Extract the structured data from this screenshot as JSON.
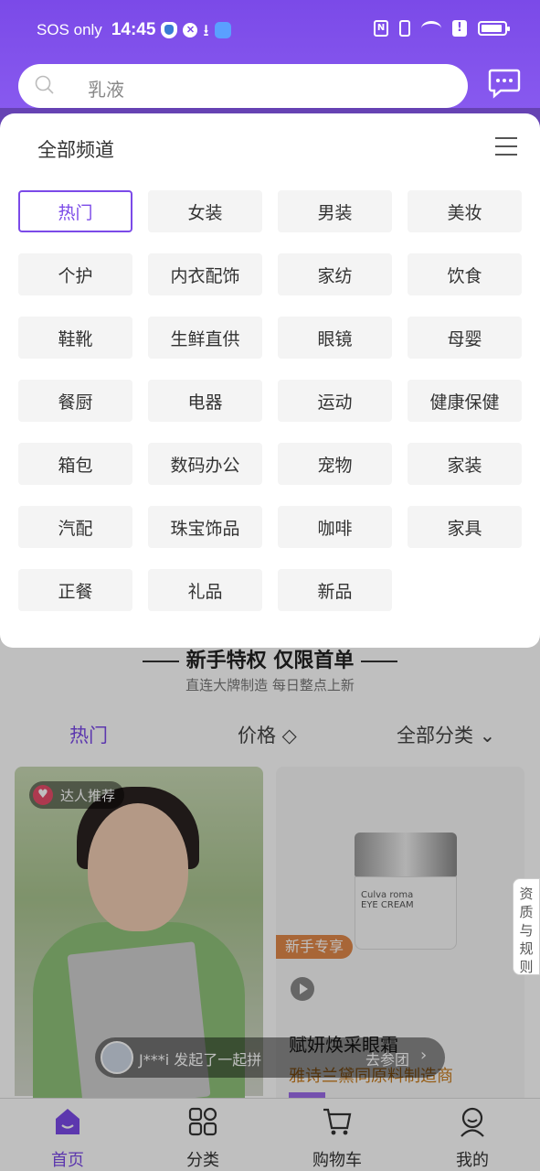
{
  "status_bar": {
    "carrier": "SOS only",
    "time": "14:45"
  },
  "search": {
    "placeholder": "乳液",
    "icon": "search-icon"
  },
  "header": {
    "chat_icon": "chat-bubble-icon"
  },
  "channel_panel": {
    "title": "全部频道",
    "menu_icon": "menu-icon",
    "channels": [
      {
        "label": "热门",
        "active": true
      },
      {
        "label": "女装",
        "active": false
      },
      {
        "label": "男装",
        "active": false
      },
      {
        "label": "美妆",
        "active": false
      },
      {
        "label": "个护",
        "active": false
      },
      {
        "label": "内衣配饰",
        "active": false
      },
      {
        "label": "家纺",
        "active": false
      },
      {
        "label": "饮食",
        "active": false
      },
      {
        "label": "鞋靴",
        "active": false
      },
      {
        "label": "生鲜直供",
        "active": false
      },
      {
        "label": "眼镜",
        "active": false
      },
      {
        "label": "母婴",
        "active": false
      },
      {
        "label": "餐厨",
        "active": false
      },
      {
        "label": "电器",
        "active": false
      },
      {
        "label": "运动",
        "active": false
      },
      {
        "label": "健康保健",
        "active": false
      },
      {
        "label": "箱包",
        "active": false
      },
      {
        "label": "数码办公",
        "active": false
      },
      {
        "label": "宠物",
        "active": false
      },
      {
        "label": "家装",
        "active": false
      },
      {
        "label": "汽配",
        "active": false
      },
      {
        "label": "珠宝饰品",
        "active": false
      },
      {
        "label": "咖啡",
        "active": false
      },
      {
        "label": "家具",
        "active": false
      },
      {
        "label": "正餐",
        "active": false
      },
      {
        "label": "礼品",
        "active": false
      },
      {
        "label": "新品",
        "active": false
      }
    ]
  },
  "promo": {
    "title": "新手特权 仅限首单",
    "subtitle": "直连大牌制造   每日整点上新"
  },
  "filters": {
    "hot": "热门",
    "price": "价格 ◇",
    "category": "全部分类 ⌄"
  },
  "cards": {
    "left": {
      "badge": "达人推荐"
    },
    "right": {
      "tag": "新手专享",
      "name": "赋妍焕采眼霜",
      "desc": "雅诗兰黛同原料制造商",
      "jar_brand": "Culva roma",
      "jar_label": "EYE CREAM"
    }
  },
  "join_banner": {
    "text": "J***i 发起了一起拼",
    "action": "去参团",
    "chevron": "›"
  },
  "rules_tab": {
    "label": "资质与规则"
  },
  "bottom_nav": {
    "items": [
      {
        "label": "首页",
        "icon": "home-icon"
      },
      {
        "label": "分类",
        "icon": "grid-icon"
      },
      {
        "label": "购物车",
        "icon": "cart-icon"
      },
      {
        "label": "我的",
        "icon": "profile-icon"
      }
    ]
  },
  "colors": {
    "accent": "#7b4ae8",
    "tag_orange": "#e0884a",
    "desc_gold": "#c87c1e"
  }
}
